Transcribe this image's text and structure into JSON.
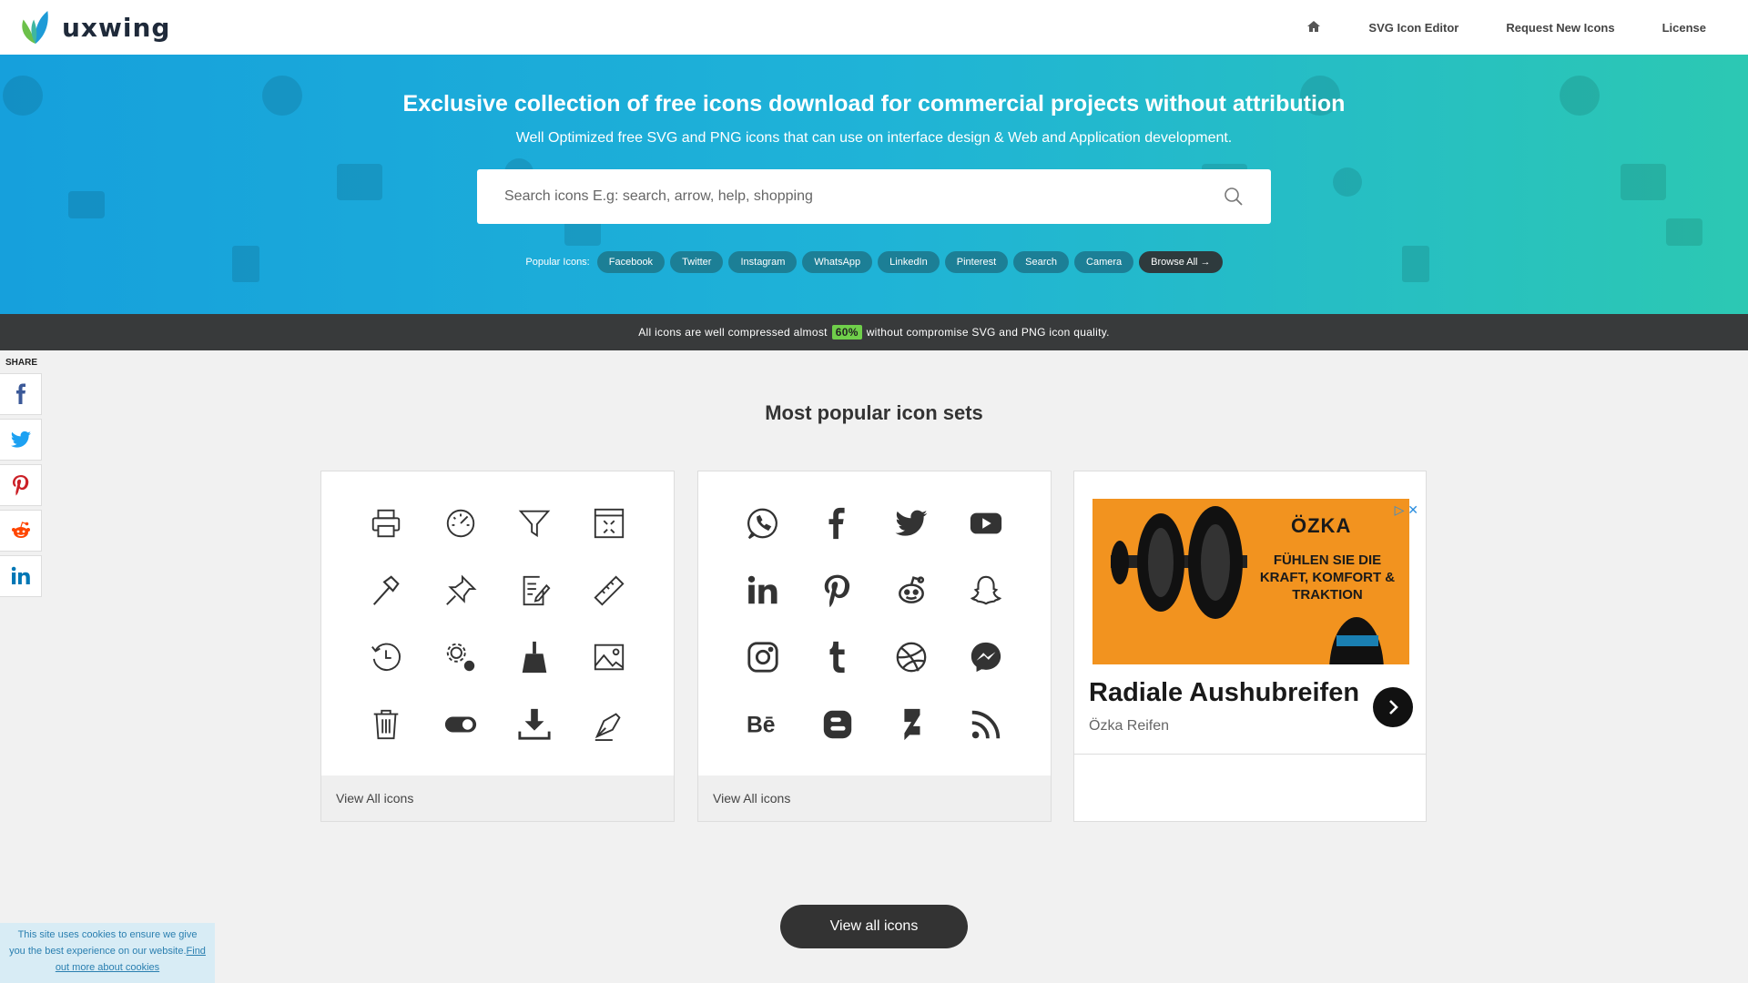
{
  "header": {
    "logo_text": "uxwing",
    "nav": {
      "home_icon": "home-icon",
      "svg_editor": "SVG Icon Editor",
      "request": "Request New Icons",
      "license": "License"
    }
  },
  "hero": {
    "title": "Exclusive collection of free icons download for commercial projects without attribution",
    "subtitle": "Well Optimized free SVG and PNG icons that can use on interface design & Web and Application development.",
    "search_placeholder": "Search icons E.g: search, arrow, help, shopping",
    "popular_label": "Popular Icons:",
    "tags": [
      "Facebook",
      "Twitter",
      "Instagram",
      "WhatsApp",
      "LinkedIn",
      "Pinterest",
      "Search",
      "Camera"
    ],
    "browse_all": "Browse All →"
  },
  "infobar": {
    "before": "All icons are well compressed almost",
    "highlight": "60%",
    "after": "without compromise SVG and PNG icon quality."
  },
  "share": {
    "label": "SHARE",
    "networks": [
      "facebook",
      "twitter",
      "pinterest",
      "reddit",
      "linkedin"
    ]
  },
  "section": {
    "title": "Most popular icon sets"
  },
  "cards": [
    {
      "footer": "View All icons",
      "icons": [
        "printer-icon",
        "speedometer-icon",
        "filter-icon",
        "minimize-window-icon",
        "hammer-icon",
        "pin-icon",
        "edit-document-icon",
        "ruler-icon",
        "history-icon",
        "settings-icon",
        "broom-icon",
        "image-icon",
        "trash-icon",
        "toggle-icon",
        "download-icon",
        "pen-tool-icon"
      ]
    },
    {
      "footer": "View All icons",
      "icons": [
        "whatsapp-icon",
        "facebook-icon",
        "twitter-icon",
        "youtube-icon",
        "linkedin-icon",
        "pinterest-icon",
        "reddit-icon",
        "snapchat-icon",
        "instagram-icon",
        "tumblr-icon",
        "dribbble-icon",
        "messenger-icon",
        "behance-icon",
        "blogger-icon",
        "deviantart-icon",
        "rss-icon"
      ]
    }
  ],
  "ad": {
    "brand": "ÖZKA",
    "slogan": "FÜHLEN SIE DIE KRAFT, KOMFORT & TRAKTION",
    "headline": "Radiale Aushubreifen",
    "source": "Özka Reifen"
  },
  "view_all_button": "View all icons",
  "cookie": {
    "text": "This site uses cookies to ensure we give you the best experience on our website.",
    "link": "Find out more about cookies"
  }
}
